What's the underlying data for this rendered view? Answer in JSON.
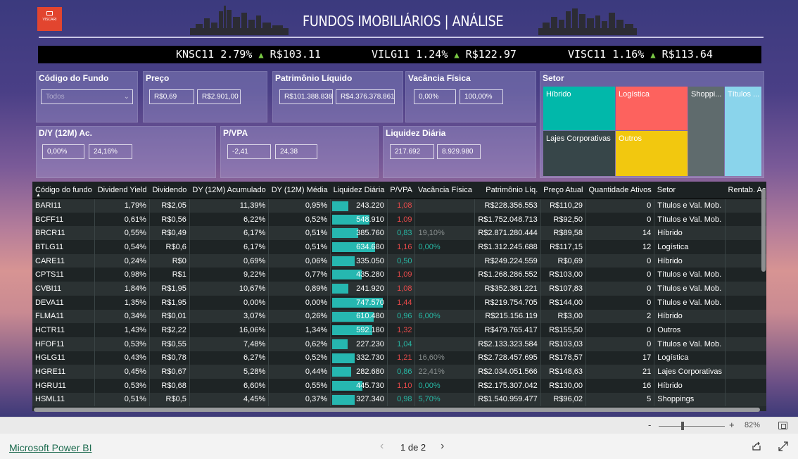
{
  "header": {
    "logo_text": "VISCARI",
    "title": "FUNDOS IMOBILIÁRIOS | ANÁLISE"
  },
  "ticker": [
    {
      "code": "KNSC11",
      "pct": "2.79%",
      "arrow": "▲",
      "price": "R$103.11"
    },
    {
      "code": "VILG11",
      "pct": "1.24%",
      "arrow": "▲",
      "price": "R$122.97"
    },
    {
      "code": "VISC11",
      "pct": "1.16%",
      "arrow": "▲",
      "price": "R$113.64"
    }
  ],
  "filters": {
    "codigo": {
      "title": "Código do Fundo",
      "placeholder": "Todos"
    },
    "preco": {
      "title": "Preço",
      "min": "R$0,69",
      "max": "R$2.901,00"
    },
    "patrimonio": {
      "title": "Patrimônio Líquido",
      "min": "R$101.388.838",
      "max": "R$4.376.378.861"
    },
    "vacancia": {
      "title": "Vacância Física",
      "min": "0,00%",
      "max": "100,00%"
    },
    "dy": {
      "title": "D/Y (12M) Ac.",
      "min": "0,00%",
      "max": "24,16%"
    },
    "pvpa": {
      "title": "P/VPA",
      "min": "-2,41",
      "max": "24,38"
    },
    "liquidez": {
      "title": "Liquidez Diária",
      "min": "217.692",
      "max": "8.929.980"
    }
  },
  "setor": {
    "title": "Setor",
    "items": [
      {
        "label": "Híbrido",
        "color": "#01b8aa"
      },
      {
        "label": "Logística",
        "color": "#fd625e"
      },
      {
        "label": "Shoppi...",
        "color": "#5f6b6d"
      },
      {
        "label": "Títulos ...",
        "color": "#8ad4eb"
      },
      {
        "label": "Lajes Corporativas",
        "color": "#374649"
      },
      {
        "label": "Outros",
        "color": "#f2c80f"
      }
    ]
  },
  "table": {
    "columns": [
      "Código do fundo",
      "Dividend Yield",
      "Dividendo",
      "DY (12M) Acumulado",
      "DY (12M) Média",
      "Liquidez Diária",
      "P/VPA",
      "Vacância Física",
      "Patrimônio Líq.",
      "Preço Atual",
      "Quantidade Ativos",
      "Setor",
      "Rentab. Acu"
    ],
    "sort_indicator": "▲",
    "liquidez_max": 747570,
    "rows": [
      {
        "codigo": "BARI11",
        "dy": "1,79%",
        "div": "R$2,05",
        "dy12": "11,39%",
        "dym": "0,95%",
        "liq": "243.220",
        "liqv": 243220,
        "pvpa": "1,08",
        "pvc": "red",
        "vac": "",
        "vacc": "",
        "pat": "R$228.356.553",
        "preco": "R$110,29",
        "qtd": "0",
        "setor": "Títulos e Val. Mob."
      },
      {
        "codigo": "BCFF11",
        "dy": "0,61%",
        "div": "R$0,56",
        "dy12": "6,22%",
        "dym": "0,52%",
        "liq": "548.910",
        "liqv": 548910,
        "pvpa": "1,09",
        "pvc": "red",
        "vac": "",
        "vacc": "",
        "pat": "R$1.752.048.713",
        "preco": "R$92,50",
        "qtd": "0",
        "setor": "Títulos e Val. Mob."
      },
      {
        "codigo": "BRCR11",
        "dy": "0,55%",
        "div": "R$0,49",
        "dy12": "6,17%",
        "dym": "0,51%",
        "liq": "385.760",
        "liqv": 385760,
        "pvpa": "0,83",
        "pvc": "teal",
        "vac": "19,10%",
        "vacc": "grey",
        "pat": "R$2.871.280.444",
        "preco": "R$89,58",
        "qtd": "14",
        "setor": "Híbrido"
      },
      {
        "codigo": "BTLG11",
        "dy": "0,54%",
        "div": "R$0,6",
        "dy12": "6,17%",
        "dym": "0,51%",
        "liq": "634.680",
        "liqv": 634680,
        "pvpa": "1,16",
        "pvc": "red",
        "vac": "0,00%",
        "vacc": "teal",
        "pat": "R$1.312.245.688",
        "preco": "R$117,15",
        "qtd": "12",
        "setor": "Logística"
      },
      {
        "codigo": "CARE11",
        "dy": "0,24%",
        "div": "R$0",
        "dy12": "0,69%",
        "dym": "0,06%",
        "liq": "335.050",
        "liqv": 335050,
        "pvpa": "0,50",
        "pvc": "teal",
        "vac": "",
        "vacc": "",
        "pat": "R$249.224.559",
        "preco": "R$0,69",
        "qtd": "0",
        "setor": "Híbrido"
      },
      {
        "codigo": "CPTS11",
        "dy": "0,98%",
        "div": "R$1",
        "dy12": "9,22%",
        "dym": "0,77%",
        "liq": "435.280",
        "liqv": 435280,
        "pvpa": "1,09",
        "pvc": "red",
        "vac": "",
        "vacc": "",
        "pat": "R$1.268.286.552",
        "preco": "R$103,00",
        "qtd": "0",
        "setor": "Títulos e Val. Mob."
      },
      {
        "codigo": "CVBI11",
        "dy": "1,84%",
        "div": "R$1,95",
        "dy12": "10,67%",
        "dym": "0,89%",
        "liq": "241.920",
        "liqv": 241920,
        "pvpa": "1,08",
        "pvc": "red",
        "vac": "",
        "vacc": "",
        "pat": "R$352.381.221",
        "preco": "R$107,83",
        "qtd": "0",
        "setor": "Títulos e Val. Mob."
      },
      {
        "codigo": "DEVA11",
        "dy": "1,35%",
        "div": "R$1,95",
        "dy12": "0,00%",
        "dym": "0,00%",
        "liq": "747.570",
        "liqv": 747570,
        "pvpa": "1,44",
        "pvc": "red",
        "vac": "",
        "vacc": "",
        "pat": "R$219.754.705",
        "preco": "R$144,00",
        "qtd": "0",
        "setor": "Títulos e Val. Mob."
      },
      {
        "codigo": "FLMA11",
        "dy": "0,34%",
        "div": "R$0,01",
        "dy12": "3,07%",
        "dym": "0,26%",
        "liq": "610.480",
        "liqv": 610480,
        "pvpa": "0,96",
        "pvc": "teal",
        "vac": "6,00%",
        "vacc": "teal",
        "pat": "R$215.156.119",
        "preco": "R$3,00",
        "qtd": "2",
        "setor": "Híbrido"
      },
      {
        "codigo": "HCTR11",
        "dy": "1,43%",
        "div": "R$2,22",
        "dy12": "16,06%",
        "dym": "1,34%",
        "liq": "592.180",
        "liqv": 592180,
        "pvpa": "1,32",
        "pvc": "red",
        "vac": "",
        "vacc": "",
        "pat": "R$479.765.417",
        "preco": "R$155,50",
        "qtd": "0",
        "setor": "Outros"
      },
      {
        "codigo": "HFOF11",
        "dy": "0,53%",
        "div": "R$0,55",
        "dy12": "7,48%",
        "dym": "0,62%",
        "liq": "227.230",
        "liqv": 227230,
        "pvpa": "1,04",
        "pvc": "teal",
        "vac": "",
        "vacc": "",
        "pat": "R$2.133.323.584",
        "preco": "R$103,03",
        "qtd": "0",
        "setor": "Títulos e Val. Mob."
      },
      {
        "codigo": "HGLG11",
        "dy": "0,43%",
        "div": "R$0,78",
        "dy12": "6,27%",
        "dym": "0,52%",
        "liq": "332.730",
        "liqv": 332730,
        "pvpa": "1,21",
        "pvc": "red",
        "vac": "16,60%",
        "vacc": "grey",
        "pat": "R$2.728.457.695",
        "preco": "R$178,57",
        "qtd": "17",
        "setor": "Logística"
      },
      {
        "codigo": "HGRE11",
        "dy": "0,45%",
        "div": "R$0,67",
        "dy12": "5,28%",
        "dym": "0,44%",
        "liq": "282.680",
        "liqv": 282680,
        "pvpa": "0,86",
        "pvc": "teal",
        "vac": "22,41%",
        "vacc": "grey",
        "pat": "R$2.034.051.566",
        "preco": "R$148,63",
        "qtd": "21",
        "setor": "Lajes Corporativas"
      },
      {
        "codigo": "HGRU11",
        "dy": "0,53%",
        "div": "R$0,68",
        "dy12": "6,60%",
        "dym": "0,55%",
        "liq": "445.730",
        "liqv": 445730,
        "pvpa": "1,10",
        "pvc": "red",
        "vac": "0,00%",
        "vacc": "teal",
        "pat": "R$2.175.307.042",
        "preco": "R$130,00",
        "qtd": "16",
        "setor": "Híbrido"
      },
      {
        "codigo": "HSML11",
        "dy": "0,51%",
        "div": "R$0,5",
        "dy12": "4,45%",
        "dym": "0,37%",
        "liq": "327.340",
        "liqv": 327340,
        "pvpa": "0,98",
        "pvc": "teal",
        "vac": "5,70%",
        "vacc": "teal",
        "pat": "R$1.540.959.477",
        "preco": "R$96,02",
        "qtd": "5",
        "setor": "Shoppings"
      }
    ]
  },
  "zoom": {
    "minus": "-",
    "plus": "+",
    "value": "82%",
    "level": 0.82
  },
  "footer": {
    "brand": "Microsoft Power BI",
    "prev": "‹",
    "page": "1 de 2",
    "next": "›"
  }
}
